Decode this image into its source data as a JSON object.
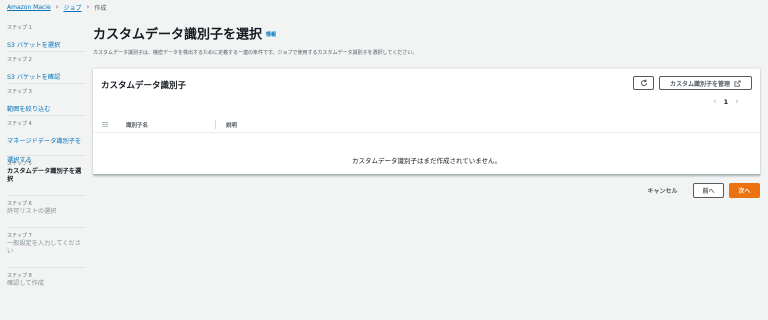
{
  "breadcrumb": {
    "items": [
      "Amazon Macie",
      "ジョブ",
      "作成"
    ]
  },
  "steps": [
    {
      "number": "ステップ 1",
      "title": "S3 バケットを選択",
      "state": "link"
    },
    {
      "number": "ステップ 2",
      "title": "S3 バケットを確認",
      "state": "link"
    },
    {
      "number": "ステップ 3",
      "title": "範囲を絞り込む",
      "state": "link"
    },
    {
      "number": "ステップ 4",
      "title": "マネージドデータ識別子を選択する",
      "state": "link"
    },
    {
      "number": "ステップ 5",
      "title": "カスタムデータ識別子を選択",
      "state": "current"
    },
    {
      "number": "ステップ 6",
      "title": "許可リストの選択",
      "state": "disabled"
    },
    {
      "number": "ステップ 7",
      "title": "一般設定を入力してください",
      "state": "disabled"
    },
    {
      "number": "ステップ 8",
      "title": "確認して作成",
      "state": "disabled"
    }
  ],
  "page": {
    "title": "カスタムデータ識別子を選択",
    "info_link": "情報",
    "description": "カスタムデータ識別子は、機密データを検出するために定義する一連の条件です。ジョブで使用するカスタムデータ識別子を選択してください。"
  },
  "panel": {
    "header": "カスタムデータ識別子",
    "refresh_icon": "refresh-icon",
    "manage_button": "カスタム識別子を管理",
    "manage_icon": "external-link-icon",
    "page_number": "1",
    "columns": [
      "識別子名",
      "説明"
    ],
    "empty_message": "カスタムデータ識別子はまだ作成されていません。"
  },
  "footer": {
    "cancel": "キャンセル",
    "previous": "前へ",
    "next": "次へ"
  },
  "colors": {
    "link": "#0073bb",
    "primary": "#ec7211",
    "background": "#f2f3f3"
  }
}
